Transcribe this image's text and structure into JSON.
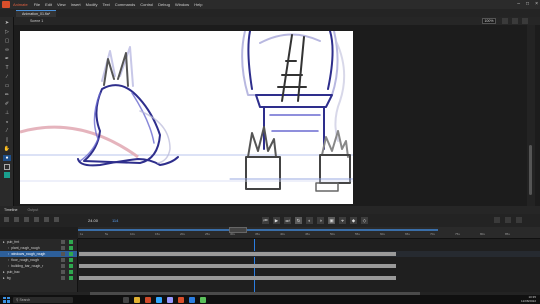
{
  "app": {
    "title": "Animate",
    "menus": [
      "File",
      "Edit",
      "View",
      "Insert",
      "Modify",
      "Text",
      "Commands",
      "Control",
      "Debug",
      "Window",
      "Help"
    ]
  },
  "document": {
    "tab_label": "Animation_01.fla*",
    "scene_label": "Scene 1",
    "zoom": "100%"
  },
  "timeline": {
    "tabs": [
      "Timeline",
      "Output"
    ],
    "fps": "24.00",
    "current_frame": "114",
    "ruler_labels": [
      "1s",
      "5s",
      "10s",
      "15s",
      "20s",
      "25s",
      "30s",
      "35s",
      "40s",
      "45s",
      "50s",
      "55s",
      "60s",
      "65s",
      "70s",
      "75s",
      "80s",
      "85s"
    ],
    "layers": [
      {
        "name": "pub_frnt",
        "level": 0,
        "selected": false
      },
      {
        "name": "plant_rough_rough",
        "level": 1,
        "selected": false
      },
      {
        "name": "windows_rough_rough",
        "level": 1,
        "selected": true
      },
      {
        "name": "floor_rough_rough",
        "level": 1,
        "selected": false
      },
      {
        "name": "building_bar_rough_r",
        "level": 1,
        "selected": false
      },
      {
        "name": "pub_bac",
        "level": 0,
        "selected": false
      },
      {
        "name": "bg",
        "level": 0,
        "selected": false
      }
    ],
    "frame_fill_fraction": [
      0,
      0,
      0.69,
      0,
      0.69,
      0,
      0.69
    ]
  },
  "taskbar": {
    "search_placeholder": "Search",
    "time": "10:35",
    "date": "12/08/2022"
  },
  "colors": {
    "accent": "#2b7de0",
    "layer_visible": "#2fa84f",
    "fill_swatch": "#1aa08e"
  }
}
